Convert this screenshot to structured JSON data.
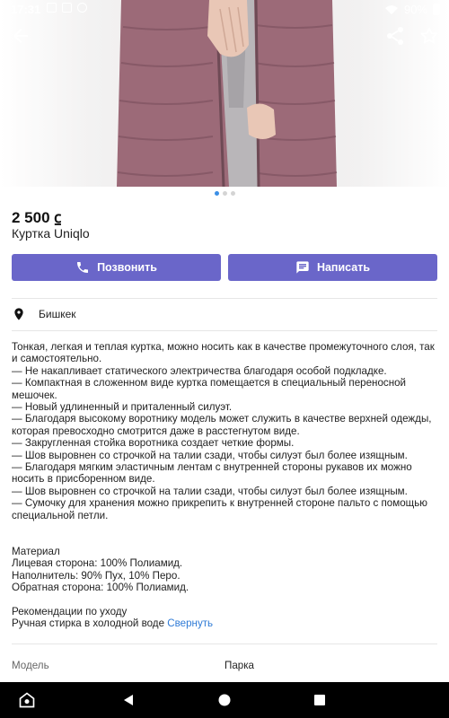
{
  "status_bar": {
    "time": "17:31",
    "battery": "90%"
  },
  "listing": {
    "price": "2 500 ⃀",
    "title": "Куртка Uniqlo"
  },
  "actions": {
    "call_label": "Позвонить",
    "write_label": "Написать"
  },
  "location": "Бишкек",
  "description": {
    "text": "Тонкая, легкая и теплая куртка, можно носить как в качестве промежуточного слоя, так и самостоятельно.\n— Не накапливает статического электричества благодаря особой подкладке.\n— Компактная в сложенном виде куртка помещается в специальный переносной мешочек.\n— Новый удлиненный и приталенный силуэт.\n— Благодаря высокому воротнику модель может служить в качестве верхней одежды, которая превосходно смотрится даже в расстегнутом виде.\n— Закругленная стойка воротника создает четкие формы.\n— Шов выровнен со строчкой на талии сзади, чтобы силуэт был более изящным.\n— Благодаря мягким эластичным лентам с внутренней стороны рукавов их можно носить в присборенном виде.\n— Шов выровнен со строчкой на талии сзади, чтобы силуэт был более изящным.\n— Сумочку для хранения можно прикрепить к внутренней стороне пальто с помощью специальной петли.\n\n\nМатериал\nЛицевая сторона: 100% Полиамид.\nНаполнитель: 90% Пух, 10% Перо.\nОбратная сторона: 100% Полиамид.\n\nРекомендации по уходу\nРучная стирка в холодной воде ",
    "collapse_label": "Свернуть"
  },
  "specs": [
    {
      "label": "Модель",
      "value": "Парка"
    }
  ],
  "carousel": {
    "count": 3,
    "active_index": 0
  },
  "colors": {
    "accent": "#6a66c9",
    "link": "#2f7bd6",
    "dot_active": "#3b8fe6"
  },
  "icons": {
    "back": "arrow-left-icon",
    "share": "share-icon",
    "favorite": "star-outline-icon",
    "phone": "phone-icon",
    "message": "message-icon",
    "location": "location-pin-icon"
  }
}
